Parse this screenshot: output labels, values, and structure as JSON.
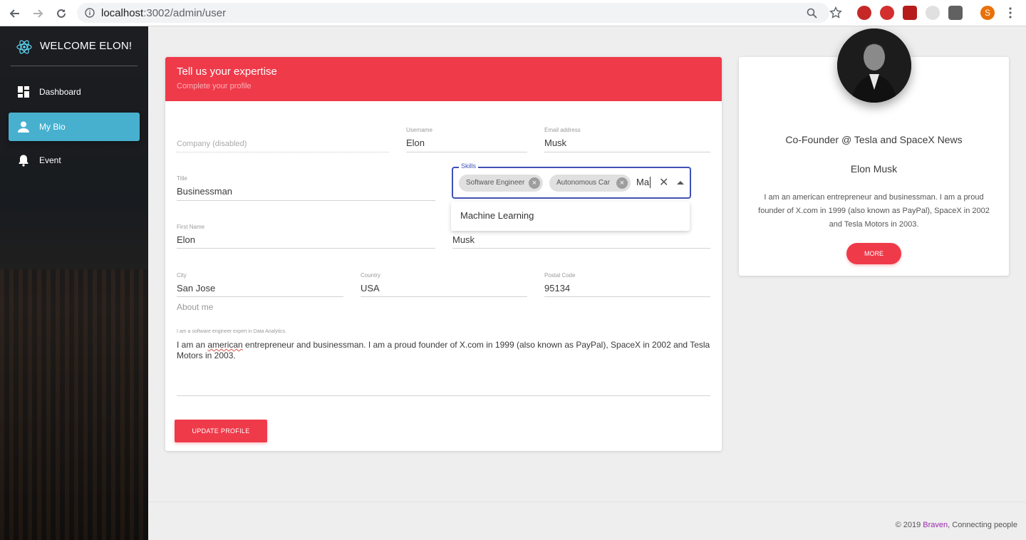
{
  "browser": {
    "url_host": "localhost",
    "url_rest": ":3002/admin/user",
    "profile_initial": "S",
    "extensions": [
      "abp-icon",
      "eab-icon",
      "puzzle-icon",
      "cookie-icon",
      "chart-icon"
    ]
  },
  "sidebar": {
    "brand": "WELCOME ELON!",
    "items": [
      {
        "label": "Dashboard",
        "icon": "dashboard-icon"
      },
      {
        "label": "My Bio",
        "icon": "person-icon",
        "active": true
      },
      {
        "label": "Event",
        "icon": "bell-icon"
      }
    ]
  },
  "form": {
    "header_title": "Tell us your expertise",
    "header_subtitle": "Complete your profile",
    "company_placeholder": "Company (disabled)",
    "username": {
      "label": "Username",
      "value": "Elon"
    },
    "email": {
      "label": "Email address",
      "value": "Musk"
    },
    "title": {
      "label": "Title",
      "value": "Businessman"
    },
    "skills": {
      "label": "Skills",
      "chips": [
        "Software Engineer",
        "Autonomous Car"
      ],
      "typed": "Ma",
      "suggestions": [
        "Machine Learning"
      ]
    },
    "first_name": {
      "label": "First Name",
      "value": "Elon"
    },
    "last_name": {
      "value": "Musk"
    },
    "city": {
      "label": "City",
      "value": "San Jose"
    },
    "country": {
      "label": "Country",
      "value": "USA"
    },
    "postal": {
      "label": "Postal Code",
      "value": "95134"
    },
    "about_heading": "About me",
    "about_label": "I am a software engineer expert in Data Analytics.",
    "about_pre": "I am an ",
    "about_misspelled": "american",
    "about_post": " entrepreneur and businessman. I am a proud founder of X.com in 1999 (also known as PayPal), SpaceX in 2002 and Tesla Motors in 2003.",
    "update_button": "UPDATE PROFILE"
  },
  "profile": {
    "subtitle": "Co-Founder @ Tesla and SpaceX News",
    "name": "Elon Musk",
    "description": "I am an american entrepreneur and businessman. I am a proud founder of X.com in 1999 (also known as PayPal), SpaceX in 2002 and Tesla Motors in 2003.",
    "more_button": "MORE"
  },
  "footer": {
    "prefix": "© 2019 ",
    "link": "Braven",
    "suffix": ", Connecting people"
  },
  "colors": {
    "accent": "#ef3a4a",
    "sidebar_active": "#48b0cf",
    "focus": "#3f51b5",
    "footer_link": "#9c27b0"
  }
}
